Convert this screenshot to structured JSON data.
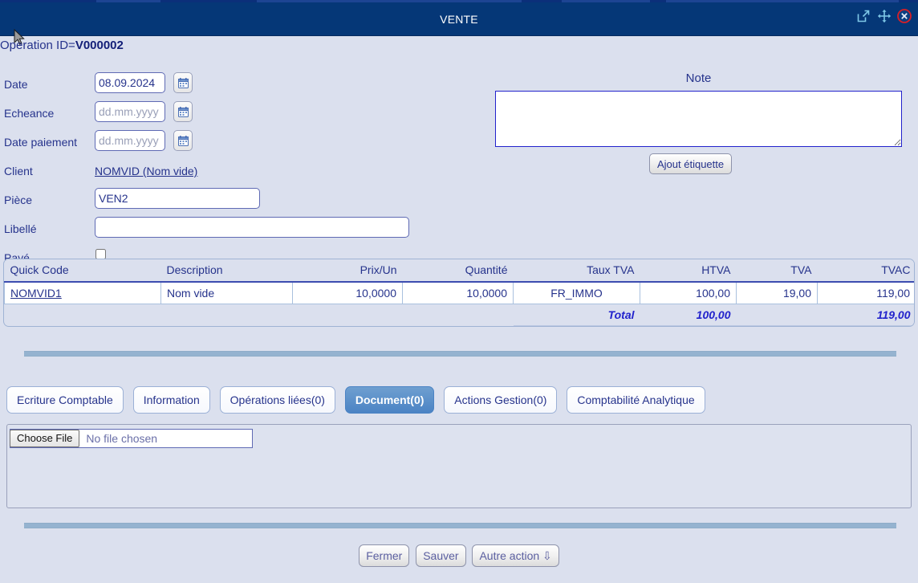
{
  "window": {
    "title": "VENTE",
    "icons": [
      {
        "name": "popout-icon",
        "glyph": "external-link"
      },
      {
        "name": "move-icon",
        "glyph": "move-arrows"
      },
      {
        "name": "close-icon",
        "glyph": "circle-x"
      }
    ]
  },
  "header": {
    "operation_id_label": "Operation ID=",
    "operation_id_value": "V000002"
  },
  "form": {
    "date": {
      "label": "Date",
      "value": "08.09.2024",
      "placeholder": "dd.mm.yyyy"
    },
    "echeance": {
      "label": "Echeance",
      "value": "",
      "placeholder": "dd.mm.yyyy"
    },
    "date_paiement": {
      "label": "Date paiement",
      "value": "",
      "placeholder": "dd.mm.yyyy"
    },
    "client": {
      "label": "Client",
      "link_text": "NOMVID (Nom vide)"
    },
    "piece": {
      "label": "Pièce",
      "value": "VEN2",
      "placeholder": ""
    },
    "libelle": {
      "label": "Libellé",
      "value": "",
      "placeholder": ""
    },
    "paye": {
      "label": "Payé",
      "checked": false
    }
  },
  "note": {
    "title": "Note",
    "value": "",
    "placeholder": "",
    "add_label_button": "Ajout étiquette"
  },
  "items_table": {
    "columns": [
      {
        "key": "quick_code",
        "label": "Quick Code",
        "align": "left"
      },
      {
        "key": "description",
        "label": "Description",
        "align": "left"
      },
      {
        "key": "prix_un",
        "label": "Prix/Un",
        "align": "right"
      },
      {
        "key": "quantite",
        "label": "Quantité",
        "align": "right"
      },
      {
        "key": "taux_tva",
        "label": "Taux TVA",
        "align": "center"
      },
      {
        "key": "htva",
        "label": "HTVA",
        "align": "right"
      },
      {
        "key": "tva",
        "label": "TVA",
        "align": "right"
      },
      {
        "key": "tvac",
        "label": "TVAC",
        "align": "right"
      }
    ],
    "rows": [
      {
        "quick_code": "NOMVID1",
        "description": "Nom vide",
        "prix_un": "10,0000",
        "quantite": "10,0000",
        "taux_tva": "FR_IMMO",
        "htva": "100,00",
        "tva": "19,00",
        "tvac": "119,00"
      }
    ],
    "total_row": {
      "label": "Total",
      "htva": "100,00",
      "tva": "",
      "tvac": "119,00"
    }
  },
  "tabs": [
    {
      "label": "Ecriture Comptable",
      "active": false
    },
    {
      "label": "Information",
      "active": false
    },
    {
      "label": "Opérations liées(0)",
      "active": false
    },
    {
      "label": "Document(0)",
      "active": true
    },
    {
      "label": "Actions Gestion(0)",
      "active": false
    },
    {
      "label": "Comptabilité Analytique",
      "active": false
    }
  ],
  "document_panel": {
    "choose_file_button": "Choose File",
    "file_chosen_text": "No file chosen"
  },
  "bottom_buttons": [
    {
      "label": "Fermer"
    },
    {
      "label": "Sauver"
    },
    {
      "label": "Autre action ⇩"
    }
  ],
  "colors": {
    "titlebar": "#053777",
    "page_background": "#dbe0ee",
    "text": "#26338c",
    "active_tab": "#4b83c4",
    "divider": "#95b3d0",
    "close_icon": "#d81f26",
    "total_text": "#2222cc"
  }
}
